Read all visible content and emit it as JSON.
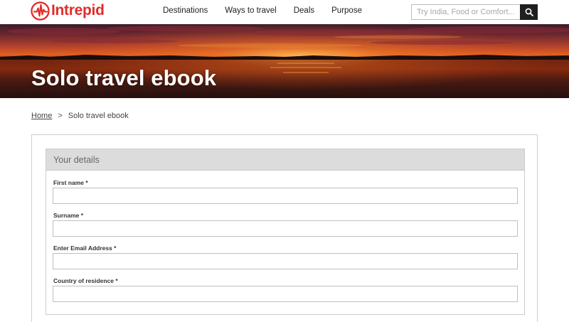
{
  "brand": {
    "name": "Intrepid",
    "color": "#e02d2a"
  },
  "nav": {
    "items": [
      "Destinations",
      "Ways to travel",
      "Deals",
      "Purpose"
    ]
  },
  "search": {
    "placeholder": "Try India, Food or Comfort...",
    "icon": "search-icon"
  },
  "hero": {
    "title": "Solo travel ebook"
  },
  "breadcrumb": {
    "home": "Home",
    "separator": ">",
    "current": "Solo travel ebook"
  },
  "form": {
    "section_title": "Your details",
    "fields": [
      {
        "label": "First name *",
        "value": ""
      },
      {
        "label": "Surname *",
        "value": ""
      },
      {
        "label": "Enter Email Address *",
        "value": ""
      },
      {
        "label": "Country of residence *",
        "value": ""
      }
    ]
  }
}
